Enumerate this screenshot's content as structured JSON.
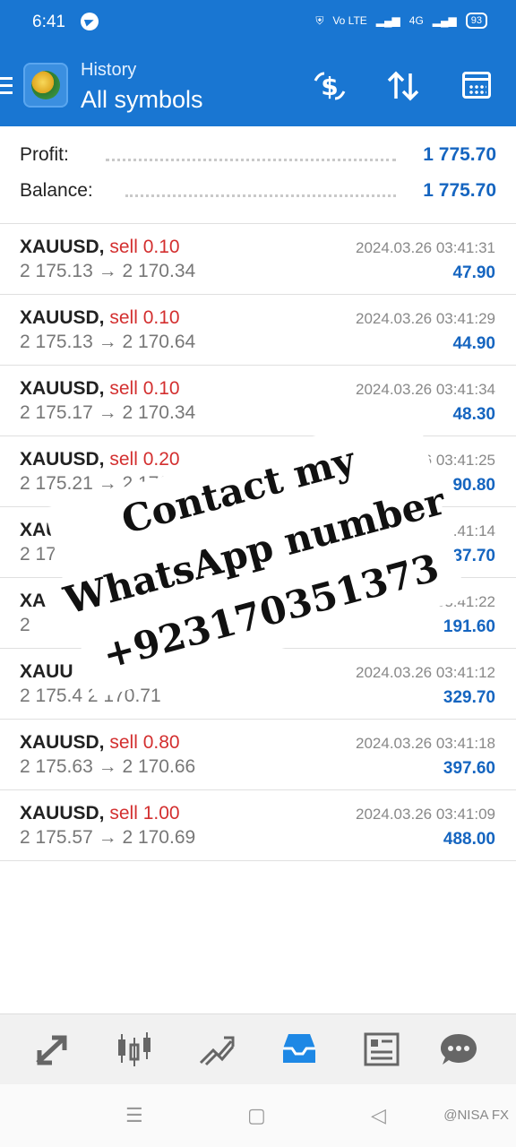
{
  "status_bar": {
    "time": "6:41",
    "battery": "93",
    "net_label": "Vo LTE",
    "signal_label": "4G"
  },
  "header": {
    "subtitle": "History",
    "title": "All symbols"
  },
  "summary": {
    "profit_label": "Profit:",
    "profit_value": "1 775.70",
    "balance_label": "Balance:",
    "balance_value": "1 775.70"
  },
  "trades": [
    {
      "symbol": "XAUUSD,",
      "side": "sell 0.10",
      "open": "2 175.13",
      "arrow": "→",
      "close": "2 170.34",
      "time": "2024.03.26 03:41:31",
      "profit": "47.90"
    },
    {
      "symbol": "XAUUSD,",
      "side": "sell 0.10",
      "open": "2 175.13",
      "arrow": "→",
      "close": "2 170.64",
      "time": "2024.03.26 03:41:29",
      "profit": "44.90"
    },
    {
      "symbol": "XAUUSD,",
      "side": "sell 0.10",
      "open": "2 175.17",
      "arrow": "→",
      "close": "2 170.34",
      "time": "2024.03.26 03:41:34",
      "profit": "48.30"
    },
    {
      "symbol": "XAUUSD,",
      "side": "sell 0.20",
      "open": "2 175.21",
      "arrow": "→",
      "close": "2 170.",
      "time": "2024.03.26 03:41:25",
      "profit": "90.80"
    },
    {
      "symbol": "XAUUSD",
      "side": "",
      "open": "2 175.30",
      "arrow": "",
      "close": "",
      "time": ".41:14",
      "profit": "137.70"
    },
    {
      "symbol": "XA",
      "side": "",
      "open": "2",
      "arrow": "",
      "close": "",
      "time": ".26 03:41:22",
      "profit": "191.60"
    },
    {
      "symbol": "XAUU",
      "side": "",
      "open": "2 175.4",
      "arrow": "",
      "close": "2 170.71",
      "time": "2024.03.26 03:41:12",
      "profit": "329.70"
    },
    {
      "symbol": "XAUUSD,",
      "side": "sell 0.80",
      "open": "2 175.63",
      "arrow": "→",
      "close": "2 170.66",
      "time": "2024.03.26 03:41:18",
      "profit": "397.60"
    },
    {
      "symbol": "XAUUSD,",
      "side": "sell 1.00",
      "open": "2 175.57",
      "arrow": "→",
      "close": "2 170.69",
      "time": "2024.03.26 03:41:09",
      "profit": "488.00"
    }
  ],
  "overlay": {
    "line1": "Contact my",
    "line2": "WhatsApp number",
    "line3": "+923170351373"
  },
  "watermark": "@NISA FX",
  "colors": {
    "accent": "#1976d2",
    "sell": "#d32f2f",
    "profit": "#1565c0",
    "active_tab": "#1e88e5"
  },
  "nav_icons": [
    "quotes-icon",
    "chart-icon",
    "trade-icon",
    "history-icon",
    "news-icon",
    "messages-icon"
  ]
}
